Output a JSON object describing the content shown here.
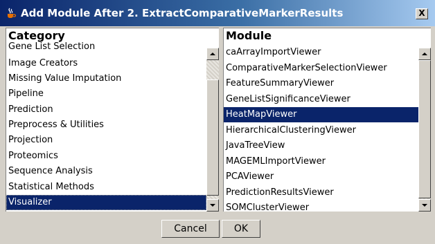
{
  "window": {
    "title": "Add Module After 2. ExtractComparativeMarkerResults",
    "close_label": "X",
    "app_icon": "java-coffee-cup-icon"
  },
  "category_panel": {
    "header": "Category",
    "items": [
      "Gene List Selection",
      "Image Creators",
      "Missing Value Imputation",
      "Pipeline",
      "Prediction",
      "Preprocess & Utilities",
      "Projection",
      "Proteomics",
      "Sequence Analysis",
      "Statistical Methods",
      "Visualizer"
    ],
    "selected": "Visualizer"
  },
  "module_panel": {
    "header": "Module",
    "items": [
      "caArrayImportViewer",
      "ComparativeMarkerSelectionViewer",
      "FeatureSummaryViewer",
      "GeneListSignificanceViewer",
      "HeatMapViewer",
      "HierarchicalClusteringViewer",
      "JavaTreeView",
      "MAGEMLImportViewer",
      "PCAViewer",
      "PredictionResultsViewer",
      "SOMClusterViewer"
    ],
    "selected": "HeatMapViewer"
  },
  "buttons": {
    "cancel": "Cancel",
    "ok": "OK"
  },
  "colors": {
    "selection": "#0a246a",
    "title_gradient_start": "#0a246a",
    "title_gradient_end": "#a6caf0"
  }
}
